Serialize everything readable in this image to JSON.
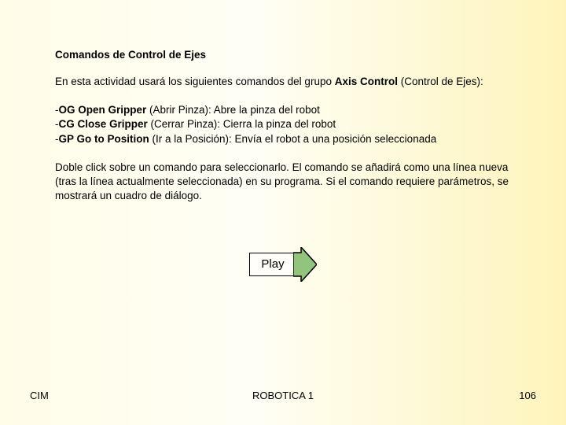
{
  "title": "Comandos de Control de Ejes",
  "intro_pre": "En esta actividad usará los siguientes comandos del grupo ",
  "intro_bold": "Axis Control",
  "intro_post": " (Control de Ejes):",
  "commands": [
    {
      "prefix": "-",
      "code": "OG Open Gripper",
      "paren": " (Abrir Pinza): Abre la pinza del robot"
    },
    {
      "prefix": "-",
      "code": "CG Close Gripper",
      "paren": " (Cerrar Pinza): Cierra la pinza del robot"
    },
    {
      "prefix": "-",
      "code": "GP Go to Position",
      "paren": " (Ir a la Posición): Envía el robot a una posición seleccionada"
    }
  ],
  "instructions": "Doble click sobre un comando para seleccionarlo. El comando se añadirá como una línea nueva (tras la línea actualmente seleccionada) en su programa. Si el comando requiere parámetros, se mostrará un cuadro de diálogo.",
  "play_label": "Play",
  "footer": {
    "left": "CIM",
    "center": "ROBOTICA 1",
    "right": "106"
  }
}
